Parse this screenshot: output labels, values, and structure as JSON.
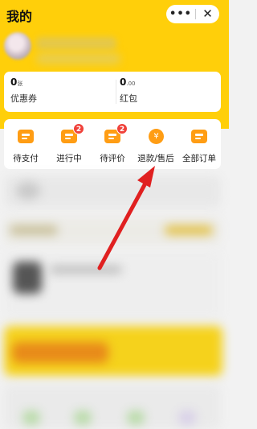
{
  "header": {
    "title": "我的",
    "more_glyph": "•••",
    "close_glyph": "✕"
  },
  "wallet": {
    "coupon": {
      "value": "0",
      "unit": "张",
      "label": "优惠券"
    },
    "red_packet": {
      "value": "0",
      "unit": ".00",
      "label": "红包"
    }
  },
  "orders": [
    {
      "label": "待支付",
      "badge": ""
    },
    {
      "label": "进行中",
      "badge": "2"
    },
    {
      "label": "待评价",
      "badge": "2"
    },
    {
      "label": "退款/售后",
      "badge": "",
      "icon_glyph": "¥"
    },
    {
      "label": "全部订单",
      "badge": ""
    }
  ],
  "colors": {
    "brand_yellow": "#ffcf0a",
    "icon_orange": "#ff9d14",
    "badge_red": "#f0413a",
    "arrow_red": "#e02020"
  }
}
